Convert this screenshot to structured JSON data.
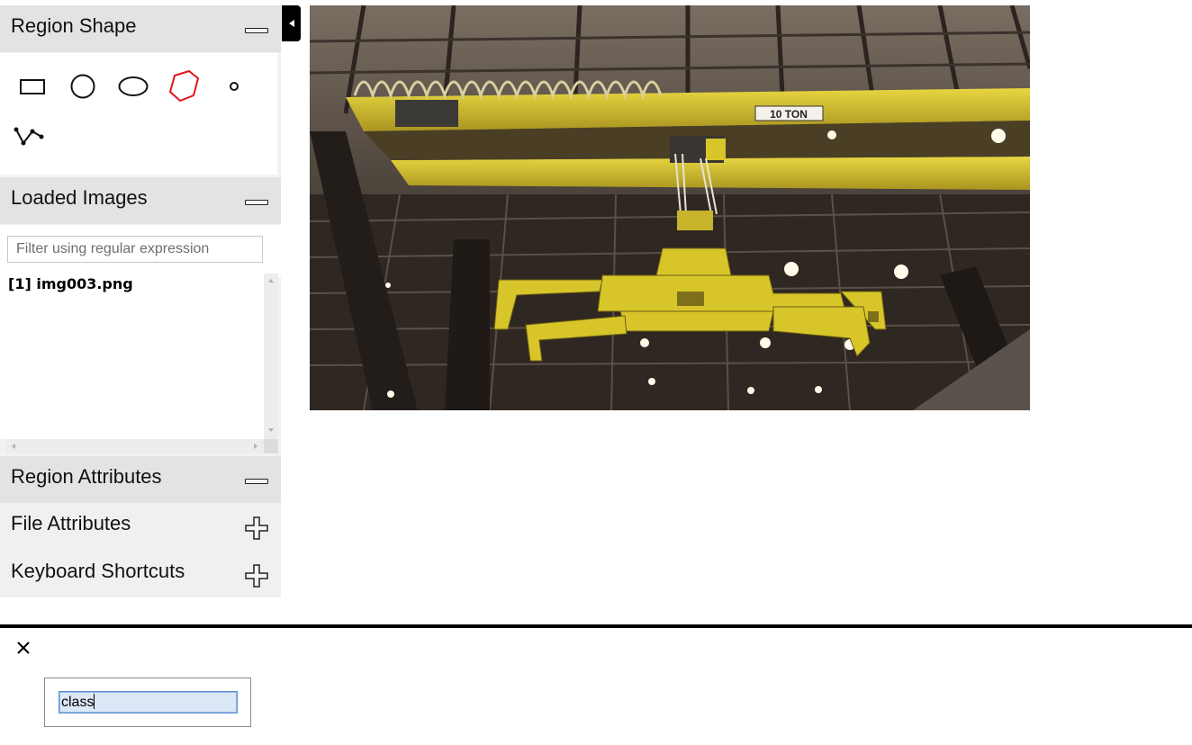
{
  "left_panel": {
    "region_shape": {
      "title": "Region Shape",
      "toggle": "minus-icon",
      "shapes": [
        {
          "name": "rectangle",
          "selected": false
        },
        {
          "name": "circle",
          "selected": false
        },
        {
          "name": "ellipse",
          "selected": false
        },
        {
          "name": "polygon",
          "selected": true
        },
        {
          "name": "point",
          "selected": false
        },
        {
          "name": "polyline",
          "selected": false
        }
      ]
    },
    "loaded_images": {
      "title": "Loaded Images",
      "toggle": "minus-icon",
      "filter_placeholder": "Filter using regular expression",
      "filter_value": "",
      "items": [
        "[1] img003.png"
      ]
    },
    "region_attributes": {
      "title": "Region Attributes",
      "toggle": "minus-icon"
    },
    "file_attributes": {
      "title": "File Attributes",
      "toggle": "plus-icon"
    },
    "keyboard_shortcuts": {
      "title": "Keyboard Shortcuts",
      "toggle": "plus-icon"
    }
  },
  "image_canvas": {
    "sign_text": "10 TON"
  },
  "attribute_editor": {
    "close_icon": "close-icon",
    "field_value": "class"
  },
  "colors": {
    "selected_shape": "#e0141a",
    "header_bg": "#e3e3e3",
    "crane_yellow": "#d8c52a"
  }
}
